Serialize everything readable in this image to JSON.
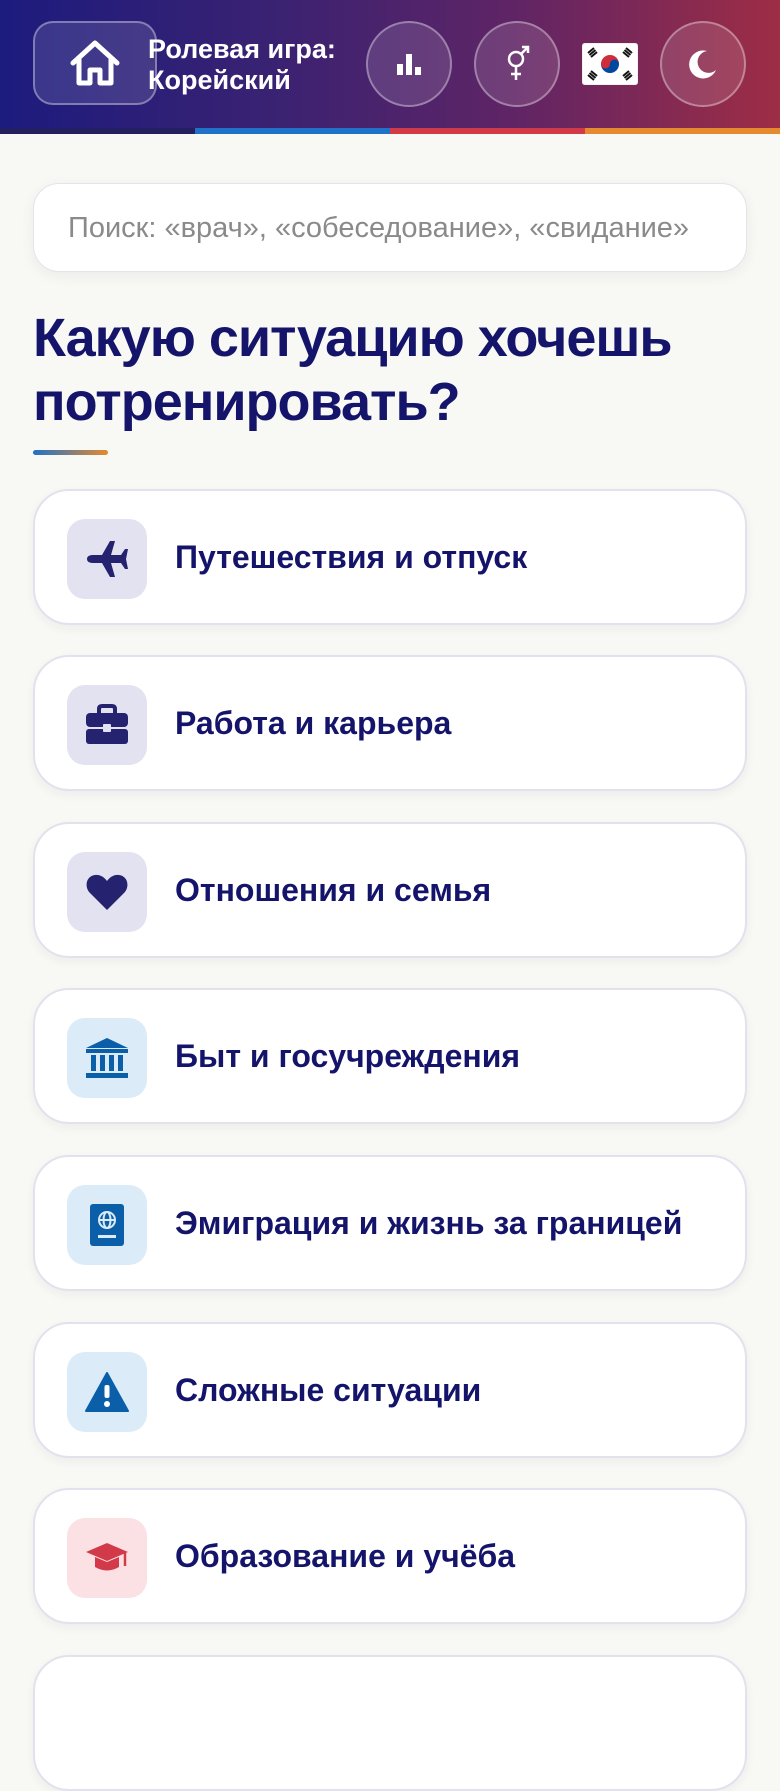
{
  "header": {
    "title_line1": "Ролевая игра:",
    "title_line2": "Корейский",
    "home_icon": "home-icon",
    "stats_icon": "bar-chart-icon",
    "gender_icon": "gender-icon",
    "flag": "🇰🇷",
    "theme_icon": "moon-icon"
  },
  "search": {
    "placeholder": "Поиск: «врач», «собеседование», «свидание»",
    "value": ""
  },
  "heading": "Какую ситуацию хочешь потренировать?",
  "categories": [
    {
      "label": "Путешествия и отпуск",
      "icon": "airplane-icon"
    },
    {
      "label": "Работа и карьера",
      "icon": "briefcase-icon"
    },
    {
      "label": "Отношения и семья",
      "icon": "heart-icon"
    },
    {
      "label": "Быт и госучреждения",
      "icon": "government-building-icon"
    },
    {
      "label": "Эмиграция и жизнь за границей",
      "icon": "passport-icon"
    },
    {
      "label": "Сложные ситуации",
      "icon": "warning-icon"
    },
    {
      "label": "Образование и учёба",
      "icon": "graduation-cap-icon"
    }
  ],
  "colors": {
    "header_gradient": [
      "#1c1b7e",
      "#5e2466",
      "#9e2d45"
    ],
    "stripe": [
      "#242060",
      "#1f72c8",
      "#d23a4a",
      "#e58a2e"
    ],
    "text_primary": "#15146b",
    "icon_bg_indigo": "#e3e2f0",
    "icon_bg_blue": "#dcebf8",
    "icon_bg_red": "#fbe1e4"
  }
}
